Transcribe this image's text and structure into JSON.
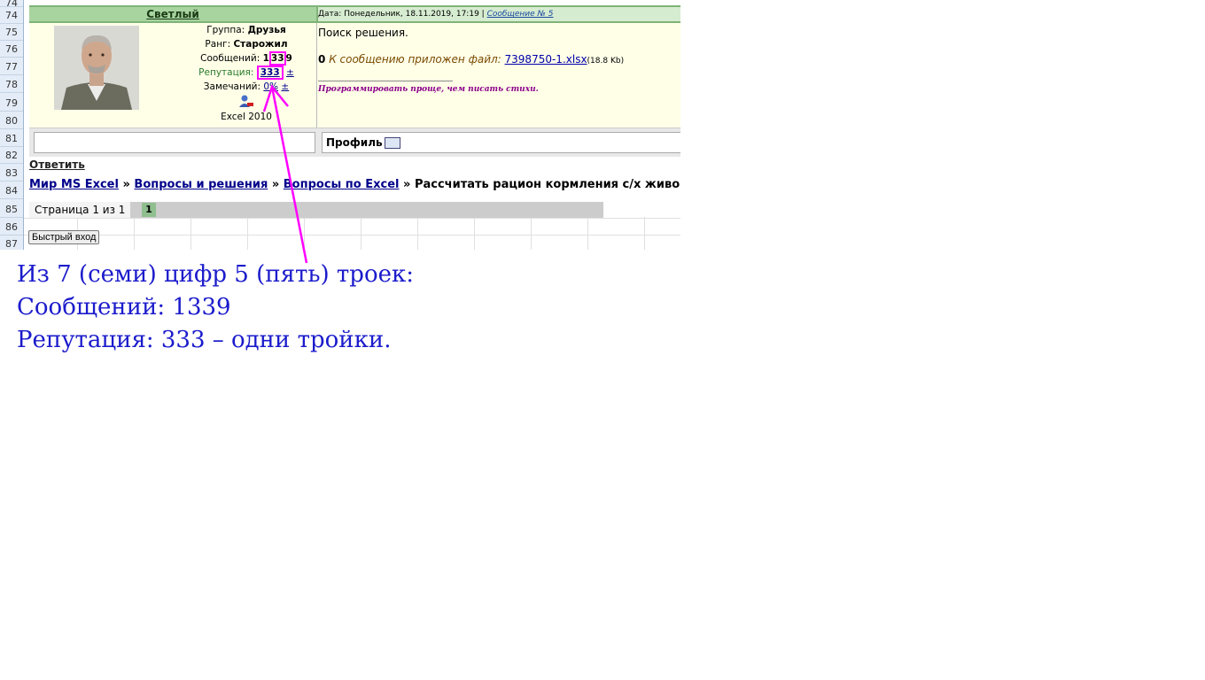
{
  "rows": [
    "74",
    "75",
    "76",
    "77",
    "78",
    "79",
    "80",
    "81",
    "82",
    "83",
    "84",
    "85",
    "86",
    "87"
  ],
  "post": {
    "author": "Светлый",
    "date_label": "Дата: Понедельник, 18.11.2019, 17:19 |",
    "msg_link": "Сообщение № 5",
    "group_label": "Группа:",
    "group_value": "Друзья",
    "rank_label": "Ранг:",
    "rank_value": "Старожил",
    "posts_label": "Сообщений:",
    "posts_value_a": "1",
    "posts_value_b": "33",
    "posts_value_c": "9",
    "rep_label": "Репутация:",
    "rep_value": "333",
    "rep_pm": "±",
    "warn_label": "Замечаний:",
    "warn_value": "0%",
    "warn_pm": "±",
    "software": "Excel 2010",
    "text": "Поиск решения.",
    "attach_prefix": "К сообщению приложен файл:",
    "attach_file": "7398750-1.xlsx",
    "attach_size": "(18.8 Kb)",
    "signature": "Программировать проще, чем писать стихи."
  },
  "actions": {
    "profile": "Профиль"
  },
  "reply": "Ответить",
  "breadcrumb": [
    "Мир MS Excel",
    "Вопросы и решения",
    "Вопросы по Excel"
  ],
  "breadcrumb_sep": "»",
  "breadcrumb_current": "Рассчитать рацион кормления с/х живо",
  "pager": {
    "text": "Страница 1 из 1",
    "current": "1"
  },
  "quick_login": "Быстрый вход",
  "annotation": {
    "line1": "Из 7 (семи) цифр 5 (пять) троек:",
    "line2": "Сообщений: 1339",
    "line3": "Репутация: 333 – одни тройки."
  },
  "colors": {
    "highlight": "#ff00ff",
    "annotation": "#1b1bcc",
    "header_green": "#a8d4a0"
  }
}
